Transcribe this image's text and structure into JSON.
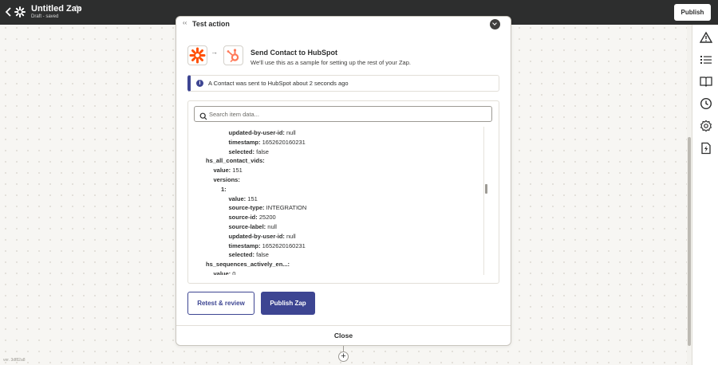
{
  "topbar": {
    "title": "Untitled Zap",
    "status": "Draft - saved",
    "publish_label": "Publish"
  },
  "panel": {
    "header_label": "Test action",
    "app_from": "zapier-logo",
    "app_to": "hubspot-logo",
    "title": "Send Contact to HubSpot",
    "subtitle": "We'll use this as a sample for setting up the rest of your Zap.",
    "alert_text": "A Contact was sent to HubSpot about 2 seconds ago",
    "search_placeholder": "Search item data...",
    "tree": [
      {
        "indent": 5,
        "key": "updated-by-user-id:",
        "value": "null"
      },
      {
        "indent": 5,
        "key": "timestamp:",
        "value": "1652620160231"
      },
      {
        "indent": 5,
        "key": "selected:",
        "value": "false"
      },
      {
        "indent": 2,
        "key": "hs_all_contact_vids:",
        "value": ""
      },
      {
        "indent": 3,
        "key": "value:",
        "value": "151"
      },
      {
        "indent": 3,
        "key": "versions:",
        "value": ""
      },
      {
        "indent": 4,
        "key": "1:",
        "value": ""
      },
      {
        "indent": 5,
        "key": "value:",
        "value": "151"
      },
      {
        "indent": 5,
        "key": "source-type:",
        "value": "INTEGRATION"
      },
      {
        "indent": 5,
        "key": "source-id:",
        "value": "25200"
      },
      {
        "indent": 5,
        "key": "source-label:",
        "value": "null"
      },
      {
        "indent": 5,
        "key": "updated-by-user-id:",
        "value": "null"
      },
      {
        "indent": 5,
        "key": "timestamp:",
        "value": "1652620160231"
      },
      {
        "indent": 5,
        "key": "selected:",
        "value": "false"
      },
      {
        "indent": 2,
        "key": "hs_sequences_actively_en...:",
        "value": ""
      },
      {
        "indent": 3,
        "key": "value:",
        "value": "0"
      }
    ],
    "retest_label": "Retest & review",
    "publish_label": "Publish Zap",
    "close_label": "Close"
  },
  "sidebar": {
    "items": [
      "alert-triangle-icon",
      "list-icon",
      "book-icon",
      "clock-icon",
      "gear-icon",
      "file-bolt-icon"
    ]
  },
  "canvas": {
    "add_step": "+",
    "version": "ver. 3df82a8"
  },
  "colors": {
    "topbar": "#2d2e2e",
    "accent": "#3d4592",
    "zapier_orange": "#ff4f00",
    "hubspot_orange": "#ff7a59"
  }
}
